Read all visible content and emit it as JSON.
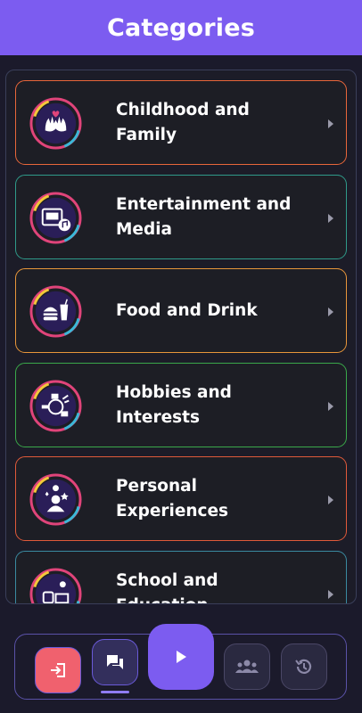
{
  "header": {
    "title": "Categories"
  },
  "categories": [
    {
      "label": "Childhood and Family",
      "line1": "Childhood and",
      "line2": "Family",
      "border": "#e8663a",
      "icon": "hands-hearts-icon"
    },
    {
      "label": "Entertainment and Media",
      "line1": "Entertainment and",
      "line2": "Media",
      "border": "#2f9a8a",
      "icon": "media-music-icon"
    },
    {
      "label": "Food and Drink",
      "line1": "Food and Drink",
      "line2": "",
      "border": "#e8963a",
      "icon": "burger-drink-icon"
    },
    {
      "label": "Hobbies and Interests",
      "line1": "Hobbies and",
      "line2": "Interests",
      "border": "#3aa84a",
      "icon": "hobbies-icon"
    },
    {
      "label": "Personal Experiences",
      "line1": "Personal",
      "line2": "Experiences",
      "border": "#e05a3a",
      "icon": "person-ideas-icon"
    },
    {
      "label": "School and Education",
      "line1": "School and",
      "line2": "Education",
      "border": "#3a8aa0",
      "icon": "school-icon"
    }
  ],
  "nav": {
    "items": [
      {
        "name": "exit",
        "icon": "exit-icon",
        "color": "#f0616e"
      },
      {
        "name": "chat",
        "icon": "chat-icon",
        "color": "#332f5c",
        "active": true
      },
      {
        "name": "play",
        "icon": "play-icon",
        "color": "#7c5cf0"
      },
      {
        "name": "people",
        "icon": "people-icon",
        "color": "#2a2940"
      },
      {
        "name": "history",
        "icon": "history-icon",
        "color": "#2a2940"
      }
    ]
  },
  "colors": {
    "accent": "#7c5cf0",
    "background": "#1b1a2b"
  }
}
